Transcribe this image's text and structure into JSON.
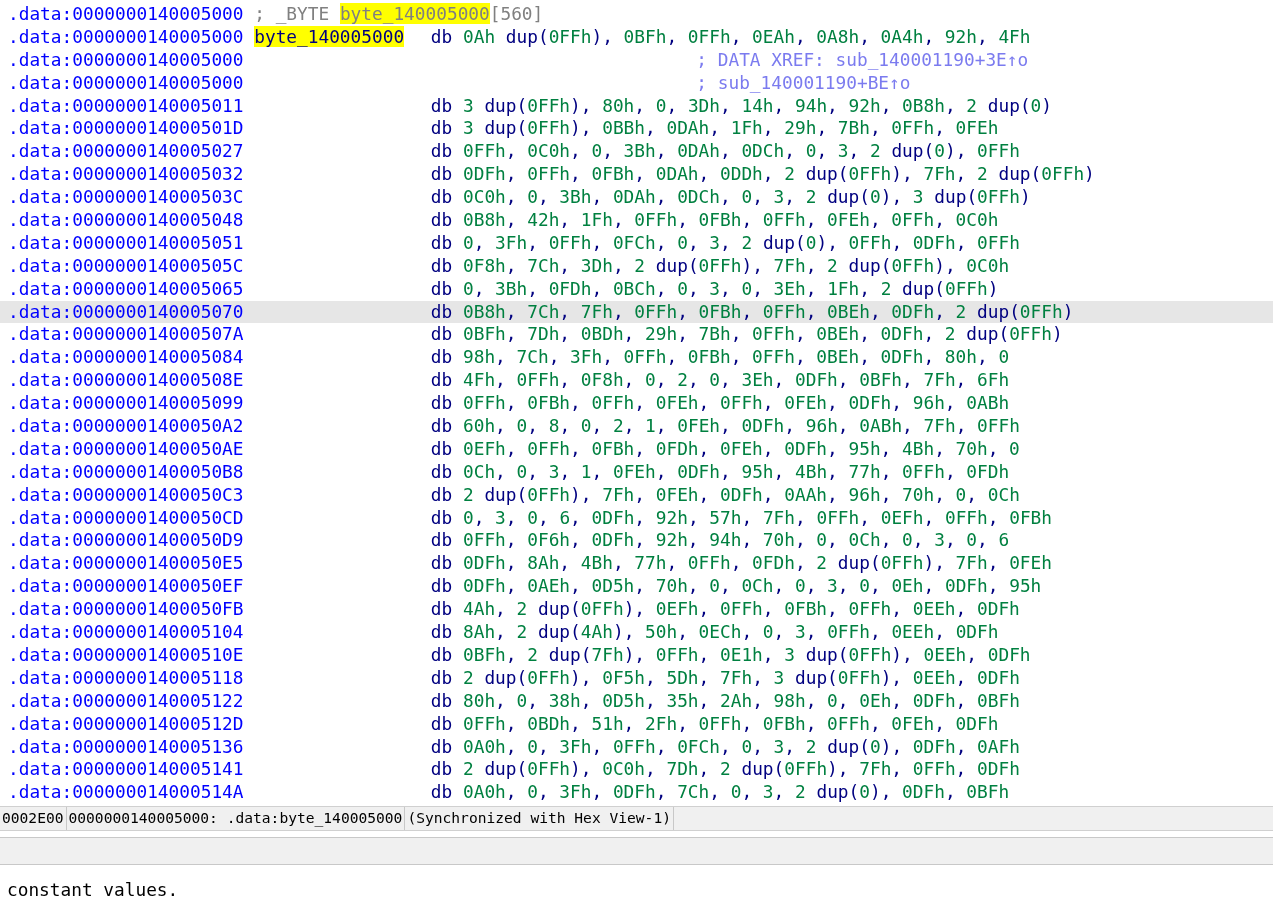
{
  "listing": {
    "rows": [
      {
        "kind": "declaration",
        "address": ".data:0000000140005000",
        "text_before": "; _BYTE ",
        "name": "byte_140005000",
        "name_highlighted": true,
        "text_after": "[560]",
        "selected": false
      },
      {
        "kind": "code",
        "address": ".data:0000000140005000",
        "label": "byte_140005000",
        "label_highlighted": true,
        "mnemonic": "db",
        "operands": "0Ah dup(0FFh), 0BFh, 0FFh, 0EAh, 0A8h, 0A4h, 92h, 4Fh",
        "selected": false
      },
      {
        "kind": "comment",
        "address": ".data:0000000140005000",
        "comment": "; DATA XREF: sub_140001190+3E↑o",
        "selected": false
      },
      {
        "kind": "comment",
        "address": ".data:0000000140005000",
        "comment": "; sub_140001190+BE↑o",
        "selected": false
      },
      {
        "kind": "code",
        "address": ".data:0000000140005011",
        "mnemonic": "db",
        "operands": "3 dup(0FFh), 80h, 0, 3Dh, 14h, 94h, 92h, 0B8h, 2 dup(0)",
        "selected": false
      },
      {
        "kind": "code",
        "address": ".data:000000014000501D",
        "mnemonic": "db",
        "operands": "3 dup(0FFh), 0BBh, 0DAh, 1Fh, 29h, 7Bh, 0FFh, 0FEh",
        "selected": false
      },
      {
        "kind": "code",
        "address": ".data:0000000140005027",
        "mnemonic": "db",
        "operands": "0FFh, 0C0h, 0, 3Bh, 0DAh, 0DCh, 0, 3, 2 dup(0), 0FFh",
        "selected": false
      },
      {
        "kind": "code",
        "address": ".data:0000000140005032",
        "mnemonic": "db",
        "operands": "0DFh, 0FFh, 0FBh, 0DAh, 0DDh, 2 dup(0FFh), 7Fh, 2 dup(0FFh)",
        "selected": false
      },
      {
        "kind": "code",
        "address": ".data:000000014000503C",
        "mnemonic": "db",
        "operands": "0C0h, 0, 3Bh, 0DAh, 0DCh, 0, 3, 2 dup(0), 3 dup(0FFh)",
        "selected": false
      },
      {
        "kind": "code",
        "address": ".data:0000000140005048",
        "mnemonic": "db",
        "operands": "0B8h, 42h, 1Fh, 0FFh, 0FBh, 0FFh, 0FEh, 0FFh, 0C0h",
        "selected": false
      },
      {
        "kind": "code",
        "address": ".data:0000000140005051",
        "mnemonic": "db",
        "operands": "0, 3Fh, 0FFh, 0FCh, 0, 3, 2 dup(0), 0FFh, 0DFh, 0FFh",
        "selected": false
      },
      {
        "kind": "code",
        "address": ".data:000000014000505C",
        "mnemonic": "db",
        "operands": "0F8h, 7Ch, 3Dh, 2 dup(0FFh), 7Fh, 2 dup(0FFh), 0C0h",
        "selected": false
      },
      {
        "kind": "code",
        "address": ".data:0000000140005065",
        "mnemonic": "db",
        "operands": "0, 3Bh, 0FDh, 0BCh, 0, 3, 0, 3Eh, 1Fh, 2 dup(0FFh)",
        "selected": false
      },
      {
        "kind": "code",
        "address": ".data:0000000140005070",
        "mnemonic": "db",
        "operands": "0B8h, 7Ch, 7Fh, 0FFh, 0FBh, 0FFh, 0BEh, 0DFh, 2 dup(0FFh)",
        "selected": true
      },
      {
        "kind": "code",
        "address": ".data:000000014000507A",
        "mnemonic": "db",
        "operands": "0BFh, 7Dh, 0BDh, 29h, 7Bh, 0FFh, 0BEh, 0DFh, 2 dup(0FFh)",
        "selected": false
      },
      {
        "kind": "code",
        "address": ".data:0000000140005084",
        "mnemonic": "db",
        "operands": "98h, 7Ch, 3Fh, 0FFh, 0FBh, 0FFh, 0BEh, 0DFh, 80h, 0",
        "selected": false
      },
      {
        "kind": "code",
        "address": ".data:000000014000508E",
        "mnemonic": "db",
        "operands": "4Fh, 0FFh, 0F8h, 0, 2, 0, 3Eh, 0DFh, 0BFh, 7Fh, 6Fh",
        "selected": false
      },
      {
        "kind": "code",
        "address": ".data:0000000140005099",
        "mnemonic": "db",
        "operands": "0FFh, 0FBh, 0FFh, 0FEh, 0FFh, 0FEh, 0DFh, 96h, 0ABh",
        "selected": false
      },
      {
        "kind": "code",
        "address": ".data:00000001400050A2",
        "mnemonic": "db",
        "operands": "60h, 0, 8, 0, 2, 1, 0FEh, 0DFh, 96h, 0ABh, 7Fh, 0FFh",
        "selected": false
      },
      {
        "kind": "code",
        "address": ".data:00000001400050AE",
        "mnemonic": "db",
        "operands": "0EFh, 0FFh, 0FBh, 0FDh, 0FEh, 0DFh, 95h, 4Bh, 70h, 0",
        "selected": false
      },
      {
        "kind": "code",
        "address": ".data:00000001400050B8",
        "mnemonic": "db",
        "operands": "0Ch, 0, 3, 1, 0FEh, 0DFh, 95h, 4Bh, 77h, 0FFh, 0FDh",
        "selected": false
      },
      {
        "kind": "code",
        "address": ".data:00000001400050C3",
        "mnemonic": "db",
        "operands": "2 dup(0FFh), 7Fh, 0FEh, 0DFh, 0AAh, 96h, 70h, 0, 0Ch",
        "selected": false
      },
      {
        "kind": "code",
        "address": ".data:00000001400050CD",
        "mnemonic": "db",
        "operands": "0, 3, 0, 6, 0DFh, 92h, 57h, 7Fh, 0FFh, 0EFh, 0FFh, 0FBh",
        "selected": false
      },
      {
        "kind": "code",
        "address": ".data:00000001400050D9",
        "mnemonic": "db",
        "operands": "0FFh, 0F6h, 0DFh, 92h, 94h, 70h, 0, 0Ch, 0, 3, 0, 6",
        "selected": false
      },
      {
        "kind": "code",
        "address": ".data:00000001400050E5",
        "mnemonic": "db",
        "operands": "0DFh, 8Ah, 4Bh, 77h, 0FFh, 0FDh, 2 dup(0FFh), 7Fh, 0FEh",
        "selected": false
      },
      {
        "kind": "code",
        "address": ".data:00000001400050EF",
        "mnemonic": "db",
        "operands": "0DFh, 0AEh, 0D5h, 70h, 0, 0Ch, 0, 3, 0, 0Eh, 0DFh, 95h",
        "selected": false
      },
      {
        "kind": "code",
        "address": ".data:00000001400050FB",
        "mnemonic": "db",
        "operands": "4Ah, 2 dup(0FFh), 0EFh, 0FFh, 0FBh, 0FFh, 0EEh, 0DFh",
        "selected": false
      },
      {
        "kind": "code",
        "address": ".data:0000000140005104",
        "mnemonic": "db",
        "operands": "8Ah, 2 dup(4Ah), 50h, 0ECh, 0, 3, 0FFh, 0EEh, 0DFh",
        "selected": false
      },
      {
        "kind": "code",
        "address": ".data:000000014000510E",
        "mnemonic": "db",
        "operands": "0BFh, 2 dup(7Fh), 0FFh, 0E1h, 3 dup(0FFh), 0EEh, 0DFh",
        "selected": false
      },
      {
        "kind": "code",
        "address": ".data:0000000140005118",
        "mnemonic": "db",
        "operands": "2 dup(0FFh), 0F5h, 5Dh, 7Fh, 3 dup(0FFh), 0EEh, 0DFh",
        "selected": false
      },
      {
        "kind": "code",
        "address": ".data:0000000140005122",
        "mnemonic": "db",
        "operands": "80h, 0, 38h, 0D5h, 35h, 2Ah, 98h, 0, 0Eh, 0DFh, 0BFh",
        "selected": false
      },
      {
        "kind": "code",
        "address": ".data:000000014000512D",
        "mnemonic": "db",
        "operands": "0FFh, 0BDh, 51h, 2Fh, 0FFh, 0FBh, 0FFh, 0FEh, 0DFh",
        "selected": false
      },
      {
        "kind": "code",
        "address": ".data:0000000140005136",
        "mnemonic": "db",
        "operands": "0A0h, 0, 3Fh, 0FFh, 0FCh, 0, 3, 2 dup(0), 0DFh, 0AFh",
        "selected": false
      },
      {
        "kind": "code",
        "address": ".data:0000000140005141",
        "mnemonic": "db",
        "operands": "2 dup(0FFh), 0C0h, 7Dh, 2 dup(0FFh), 7Fh, 0FFh, 0DFh",
        "selected": false
      },
      {
        "kind": "code",
        "address": ".data:000000014000514A",
        "mnemonic": "db",
        "operands": "0A0h, 0, 3Fh, 0DFh, 7Ch, 0, 3, 2 dup(0), 0DFh, 0BFh",
        "selected": false
      }
    ]
  },
  "status_bar": [
    "0002E00",
    "0000000140005000: .data:byte_140005000",
    "(Synchronized with Hex View-1)"
  ],
  "output": {
    "lines": [
      "constant values."
    ]
  }
}
